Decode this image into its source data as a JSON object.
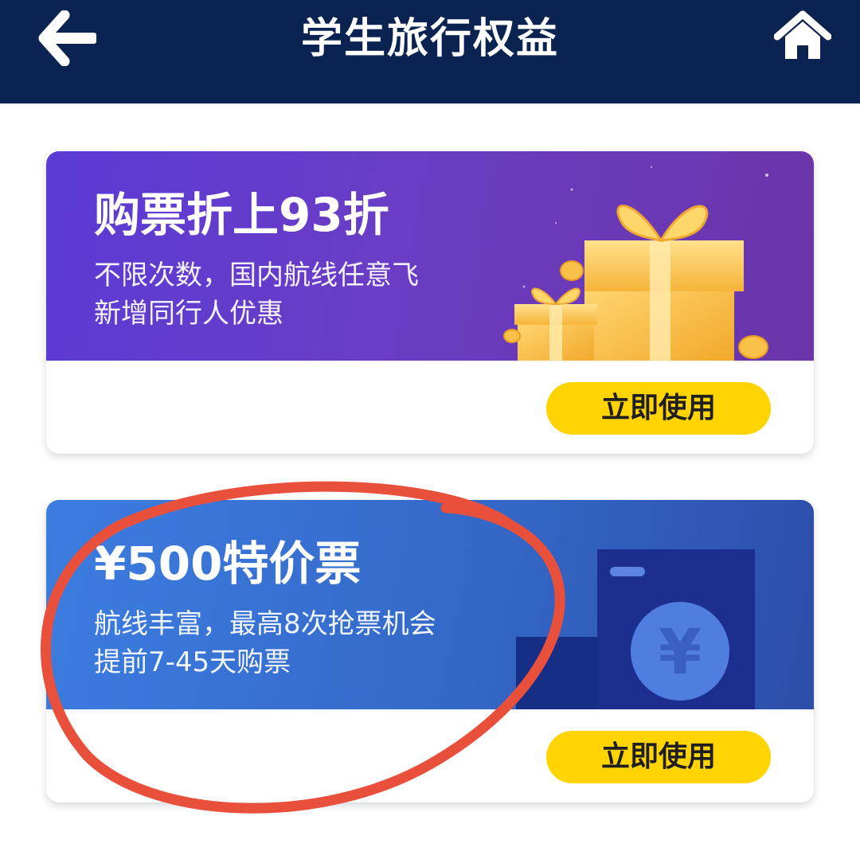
{
  "header": {
    "title": "学生旅行权益",
    "back_icon": "arrow-left-icon",
    "home_icon": "home-icon",
    "background": "#0b2350"
  },
  "cards": [
    {
      "title": "购票折上93折",
      "lines": [
        "不限次数，国内航线任意飞",
        "新增同行人优惠"
      ],
      "button_label": "立即使用",
      "illustration": "gift-box-icon"
    },
    {
      "title": "¥500特价票",
      "lines": [
        "航线丰富，最高8次抢票机会",
        "提前7-45天购票"
      ],
      "button_label": "立即使用",
      "illustration": "ticket-yen-icon",
      "yen_symbol": "¥"
    }
  ],
  "colors": {
    "button": "#ffd400",
    "annotation_circle": "#e8503c"
  }
}
